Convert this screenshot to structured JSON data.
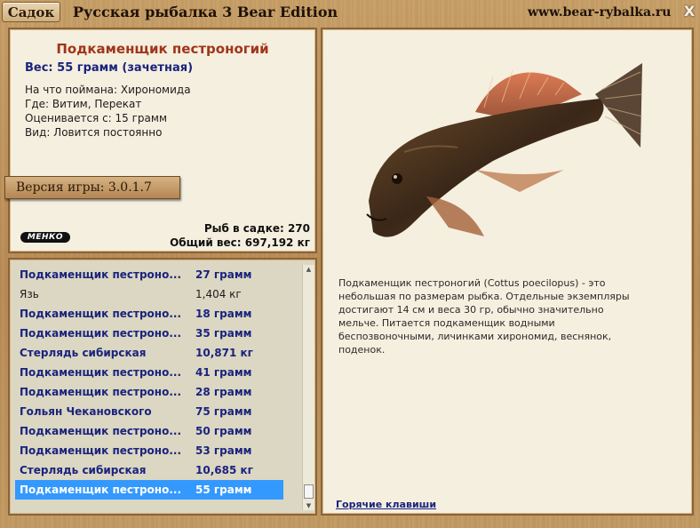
{
  "titlebar": {
    "sadok_button": "Садок",
    "app_title": "Русская рыбалка 3 Bear Edition",
    "site_url": "www.bear-rybalka.ru",
    "close": "X"
  },
  "fish_info": {
    "name": "Подкаменщик пестроногий",
    "weight": "Вес: 55 грамм (зачетная)",
    "caught_on": "На что поймана: Хирономида",
    "where": "Где: Витим, Перекат",
    "rated_from": "Оценивается с: 15 грамм",
    "type": "Вид: Ловится постоянно",
    "version": "Версия игры: 3.0.1.7",
    "logo_text": "МЕНКО",
    "fish_count": "Рыб в садке: 270",
    "total_weight": "Общий вес: 697,192 кг"
  },
  "fish_list": [
    {
      "name": "Подкаменщик пестроно...",
      "weight": "27 грамм",
      "highlight": true
    },
    {
      "name": "Язь",
      "weight": "1,404 кг",
      "highlight": false
    },
    {
      "name": "Подкаменщик пестроно...",
      "weight": "18 грамм",
      "highlight": true
    },
    {
      "name": "Подкаменщик пестроно...",
      "weight": "35 грамм",
      "highlight": true
    },
    {
      "name": "Стерлядь сибирская",
      "weight": "10,871 кг",
      "highlight": true
    },
    {
      "name": "Подкаменщик пестроно...",
      "weight": "41 грамм",
      "highlight": true
    },
    {
      "name": "Подкаменщик пестроно...",
      "weight": "28 грамм",
      "highlight": true
    },
    {
      "name": "Гольян Чекановского",
      "weight": "75 грамм",
      "highlight": true
    },
    {
      "name": "Подкаменщик пестроно...",
      "weight": "50 грамм",
      "highlight": true
    },
    {
      "name": "Подкаменщик пестроно...",
      "weight": "53 грамм",
      "highlight": true
    },
    {
      "name": "Стерлядь сибирская",
      "weight": "10,685 кг",
      "highlight": true
    },
    {
      "name": "Подкаменщик пестроно...",
      "weight": "55 грамм",
      "highlight": true,
      "selected": true
    }
  ],
  "detail": {
    "description": "Подкаменщик пестроногий (Cottus poecilopus) - это небольшая по размерам рыбка. Отдельные экземпляры достигают 14 см и веса 30 гр, обычно значительно мельче. Питается подкаменщик водными беспозвоночными, личинками хирономид, веснянок, поденок.",
    "hotkeys_link": "Горячие клавиши"
  },
  "colors": {
    "fish_name": "#a0351b",
    "highlight_text": "#1a237e",
    "selection": "#3399ff",
    "panel_bg": "#f5efdf",
    "wood": "#c79f68"
  }
}
